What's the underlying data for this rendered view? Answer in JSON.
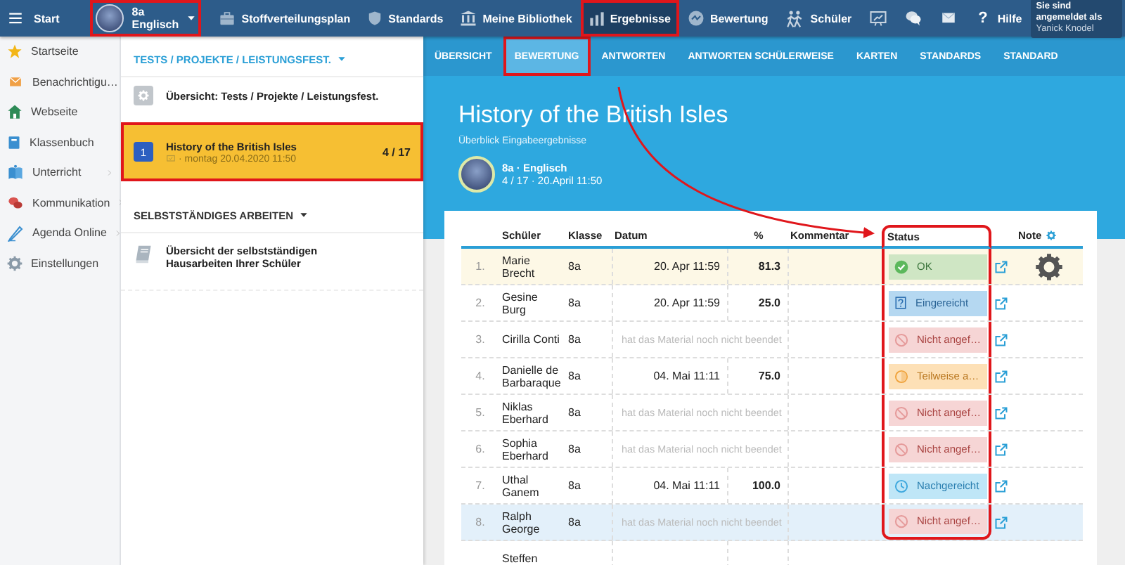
{
  "annotation_arrow": true,
  "topbar": {
    "menu_label": "Start",
    "class_selector": {
      "class": "8a",
      "subject": "Englisch",
      "annotated": true
    },
    "nav": [
      {
        "label": "Stoffverteilungsplan",
        "selected": false,
        "annotated": false
      },
      {
        "label": "Standards",
        "selected": false,
        "annotated": false
      },
      {
        "label": "Meine Bibliothek",
        "selected": false,
        "annotated": false
      },
      {
        "label": "Ergebnisse",
        "selected": true,
        "annotated": true
      },
      {
        "label": "Bewertung",
        "selected": false,
        "annotated": false
      },
      {
        "label": "Schüler",
        "selected": false,
        "annotated": false
      },
      {
        "selected": false,
        "annotated": false
      },
      {
        "selected": false,
        "annotated": false
      },
      {
        "selected": false,
        "annotated": false
      },
      {
        "glyph": "?",
        "label": "Hilfe",
        "selected": false,
        "annotated": false
      }
    ],
    "login": {
      "caption": "Sie sind angemeldet als",
      "user": "Yanick Knodel"
    }
  },
  "sidebar": {
    "items": [
      {
        "label": "Startseite",
        "expandable": false
      },
      {
        "label": "Benachrichtigu…",
        "expandable": false
      },
      {
        "label": "Webseite",
        "expandable": false
      },
      {
        "label": "Klassenbuch",
        "expandable": false
      },
      {
        "label": "Unterricht",
        "expandable": true
      },
      {
        "label": "Kommunikation",
        "expandable": true
      },
      {
        "label": "Agenda Online",
        "expandable": true
      },
      {
        "label": "Einstellungen",
        "expandable": false
      }
    ]
  },
  "panel": {
    "sections": [
      {
        "title": "TESTS / PROJEKTE / LEISTUNGSFEST.",
        "items": [
          {
            "kind": "overview",
            "title": "Übersicht: Tests / Projekte / Leistungsfest.",
            "selected": false,
            "annotated": false
          },
          {
            "kind": "test",
            "number": "1",
            "title": "History of the British Isles",
            "meta": "· montag 20.04.2020 11:50",
            "count": "4 / 17",
            "selected": true,
            "annotated": true
          }
        ]
      },
      {
        "title": "SELBSTSTÄNDIGES ARBEITEN",
        "items": [
          {
            "kind": "homework",
            "title": "Übersicht der selbstständigen Hausarbeiten Ihrer Schüler",
            "selected": false,
            "annotated": false
          }
        ]
      }
    ]
  },
  "content": {
    "tabs": [
      {
        "label": "ÜBERSICHT",
        "selected": false,
        "annotated": false
      },
      {
        "label": "BEWERTUNG",
        "selected": true,
        "annotated": true
      },
      {
        "label": "ANTWORTEN",
        "selected": false,
        "annotated": false
      },
      {
        "label": "ANTWORTEN SCHÜLERWEISE",
        "selected": false,
        "annotated": false
      },
      {
        "label": "KARTEN",
        "selected": false,
        "annotated": false
      },
      {
        "label": "STANDARDS",
        "selected": false,
        "annotated": false
      },
      {
        "label": "STANDARD",
        "selected": false,
        "annotated": false
      }
    ],
    "title": "History of the British Isles",
    "subtitle": "Überblick Eingabeergebnisse",
    "class_info": "8a · Englisch",
    "meta": "4 / 17 · 20.April 11:50"
  },
  "table": {
    "columns": [
      {
        "kind": "number"
      },
      {
        "kind": "text",
        "label": "Schüler"
      },
      {
        "kind": "text",
        "label": "Klasse"
      },
      {
        "kind": "text",
        "label": "Datum"
      },
      {
        "kind": "center",
        "label": "%"
      },
      {
        "kind": "text",
        "label": "Kommentar"
      },
      {
        "kind": "status",
        "label": "Status",
        "annotated": true
      },
      {
        "kind": "link"
      },
      {
        "kind": "note",
        "label": "Note"
      }
    ],
    "rows": [
      {
        "number": "1.",
        "name": "Marie Brecht",
        "klasse": "8a",
        "date": "20. Apr 11:59",
        "percent": "81.3",
        "status": {
          "kind": "ok",
          "label": "OK"
        },
        "note_settings": true,
        "color": "#fdf8e6"
      },
      {
        "number": "2.",
        "name": "Gesine Burg",
        "klasse": "8a",
        "date": "20. Apr 11:59",
        "percent": "25.0",
        "status": {
          "kind": "submitted",
          "label": "Eingereicht"
        },
        "note_settings": false,
        "color": "#ffffff"
      },
      {
        "number": "3.",
        "name": "Cirilla Conti",
        "klasse": "8a",
        "remark": "hat das Material noch nicht beendet",
        "status": {
          "kind": "missing",
          "label": "Nicht angef…"
        },
        "note_settings": false,
        "color": "#ffffff"
      },
      {
        "number": "4.",
        "name": "Danielle de Barbaraque",
        "klasse": "8a",
        "date": "04. Mai 11:11",
        "percent": "75.0",
        "status": {
          "kind": "partial",
          "label": "Teilweise a…"
        },
        "note_settings": false,
        "color": "#ffffff"
      },
      {
        "number": "5.",
        "name": "Niklas Eberhard",
        "klasse": "8a",
        "remark": "hat das Material noch nicht beendet",
        "status": {
          "kind": "missing",
          "label": "Nicht angef…"
        },
        "note_settings": false,
        "color": "#ffffff"
      },
      {
        "number": "6.",
        "name": "Sophia Eberhard",
        "klasse": "8a",
        "remark": "hat das Material noch nicht beendet",
        "status": {
          "kind": "missing",
          "label": "Nicht angef…"
        },
        "note_settings": false,
        "color": "#ffffff"
      },
      {
        "number": "7.",
        "name": "Uthal Ganem",
        "klasse": "8a",
        "date": "04. Mai 11:11",
        "percent": "100.0",
        "status": {
          "kind": "late",
          "label": "Nachgereicht"
        },
        "note_settings": false,
        "color": "#ffffff"
      },
      {
        "number": "8.",
        "name": "Ralph George",
        "klasse": "8a",
        "remark": "hat das Material noch nicht beendet",
        "status": {
          "kind": "missing",
          "label": "Nicht angef…"
        },
        "note_settings": false,
        "color": "#e3f0fa"
      },
      {
        "name": "Steffen",
        "note_settings": false,
        "color": "#ffffff"
      }
    ]
  }
}
